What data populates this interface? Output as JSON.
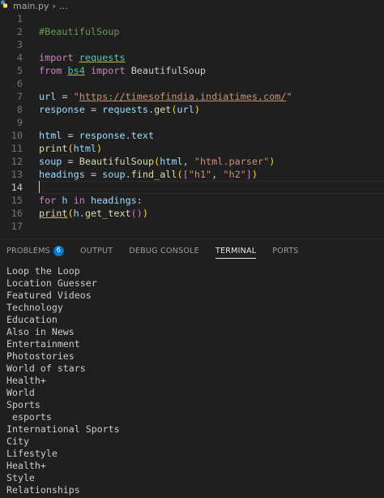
{
  "breadcrumb": {
    "file": "main.py",
    "more": "…"
  },
  "editor": {
    "line_numbers": [
      "1",
      "2",
      "3",
      "4",
      "5",
      "6",
      "7",
      "8",
      "9",
      "10",
      "11",
      "12",
      "13",
      "14",
      "15",
      "16",
      "17"
    ]
  },
  "panel": {
    "tabs": [
      {
        "label": "PROBLEMS",
        "badge": "6"
      },
      {
        "label": "OUTPUT"
      },
      {
        "label": "DEBUG CONSOLE"
      },
      {
        "label": "TERMINAL"
      },
      {
        "label": "PORTS"
      }
    ]
  },
  "terminal": {
    "lines": [
      "Loop the Loop",
      "Location Guesser",
      "Featured Videos",
      "Technology",
      "Education",
      "Also in News",
      "Entertainment",
      "Photostories",
      "World of stars",
      "Health+",
      "World",
      "Sports",
      " esports",
      "International Sports",
      "City",
      "Lifestyle",
      "Health+",
      "Style",
      "Relationships"
    ]
  },
  "colors": {
    "background": "#1f1f1f",
    "keyword": "#c586c0",
    "function": "#dcdcaa",
    "variable": "#9cdcfe",
    "string": "#ce9178",
    "comment": "#6a9955",
    "badge": "#0078d4"
  },
  "icons": {
    "file": "python-file-icon"
  }
}
